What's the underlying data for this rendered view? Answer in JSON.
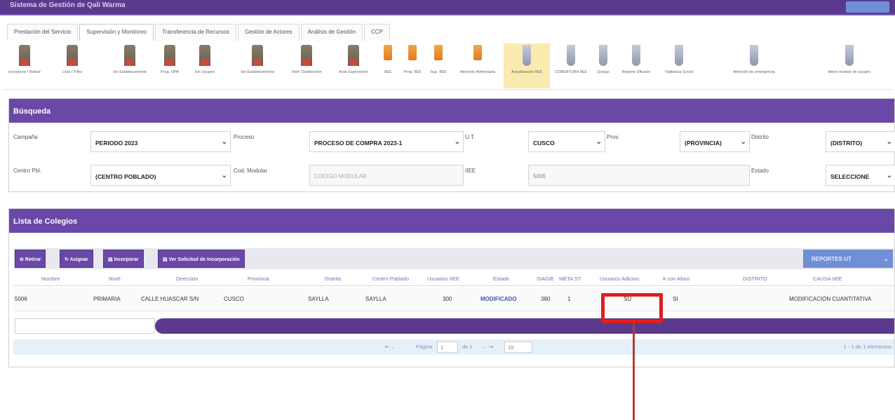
{
  "app": {
    "title": "Sistema de Gestión de Qali Warma"
  },
  "tabs": [
    {
      "label": "Prestación del Servicio"
    },
    {
      "label": "Supervisión y Monitoreo"
    },
    {
      "label": "Transferencia de Recursos"
    },
    {
      "label": "Gestión de Actores"
    },
    {
      "label": "Análisis de Gestión"
    },
    {
      "label": "CCP"
    }
  ],
  "toolbar_icons": [
    {
      "label": "Incorporar / Retirar",
      "icon": "school-icon"
    },
    {
      "label": "Lista / Filtro",
      "icon": "school-icon"
    },
    {
      "label": "Sin Establecimiento",
      "icon": "school-icon"
    },
    {
      "label": "Prog. OPA",
      "icon": "school-icon"
    },
    {
      "label": "Sin Usuario",
      "icon": "school-icon"
    },
    {
      "label": "Sin Establecimiento",
      "icon": "school-icon"
    },
    {
      "label": "Verif. Distribución",
      "icon": "school-icon"
    },
    {
      "label": "Acta Supervisión",
      "icon": "school-icon"
    },
    {
      "label": "IIEE",
      "icon": "document-icon"
    },
    {
      "label": "Prog. IIEE",
      "icon": "document-icon"
    },
    {
      "label": "Sup. IIEE",
      "icon": "document-icon"
    },
    {
      "label": "Atención Alimentaria",
      "icon": "document-icon"
    },
    {
      "label": "Actualización IIEE",
      "icon": "tool-icon"
    },
    {
      "label": "COBERTURA IIEE",
      "icon": "tool-icon"
    },
    {
      "label": "Quejas",
      "icon": "tool-icon"
    },
    {
      "label": "Reporte Difusión",
      "icon": "tool-icon"
    },
    {
      "label": "Vigilancia Social",
      "icon": "tool-icon"
    },
    {
      "label": "Atención de emergencia",
      "icon": "tool-icon"
    },
    {
      "label": "Menú modelo de usuario",
      "icon": "tool-icon"
    }
  ],
  "search": {
    "title": "Búsqueda",
    "fields": {
      "campania_label": "Campaña",
      "campania_value": "PERIODO 2023",
      "proceso_label": "Proceso",
      "proceso_value": "PROCESO DE COMPRA 2023-1",
      "ut_label": "U.T.",
      "ut_value": "CUSCO",
      "prov_label": "Prov.",
      "prov_value": "(PROVINCIA)",
      "distrito_label": "Distrito",
      "distrito_value": "(DISTRITO)",
      "centro_label": "Centro Pbl.",
      "centro_value": "(CENTRO POBLADO)",
      "codmodular_label": "Cod. Modular",
      "codmodular_placeholder": "CODIGO MODULAR",
      "iiee_label": "IIEE",
      "iiee_value": "5006",
      "estado_label": "Estado",
      "estado_value": "SELECCIONE"
    }
  },
  "list": {
    "title": "Lista de Colegios",
    "buttons": {
      "retirar": "Retirar",
      "asignar": "Asignar",
      "incorporar": "Incorporar",
      "solicitud": "Ver Solicitud de Incorporación",
      "reporte": "REPORTES UT"
    },
    "columns": [
      "Nombre",
      "Nivel",
      "Dirección",
      "Provincia",
      "Distrito",
      "Centro Poblado",
      "Usuarios IIEE",
      "Estado",
      "SIAGIE",
      "META ST",
      "Usuarios Adicion.",
      "# con Aforo",
      "DISTRITO",
      "CAUSA IIEE"
    ],
    "rows": [
      {
        "nombre": "5006",
        "nivel": "PRIMARIA",
        "direccion": "CALLE HUASCAR S/N",
        "provincia": "CUSCO",
        "distrito": "SAYLLA",
        "centro": "SAYLLA",
        "usuarios": "300",
        "estado": "MODIFICADO",
        "siagie": "380",
        "meta": "1",
        "adicion": "SU",
        "aforo": "SI",
        "distrito2": "",
        "causa": "MODIFICACIÓN CUANTITATIVA"
      }
    ],
    "pager": {
      "page_label": "Página",
      "page_value": "1",
      "of_label": "de 1",
      "per_page": "10",
      "summary": "1 - 1 de 1 elementos"
    }
  },
  "colors": {
    "header": "#6a48a8",
    "annotation": "#e01e1e"
  }
}
